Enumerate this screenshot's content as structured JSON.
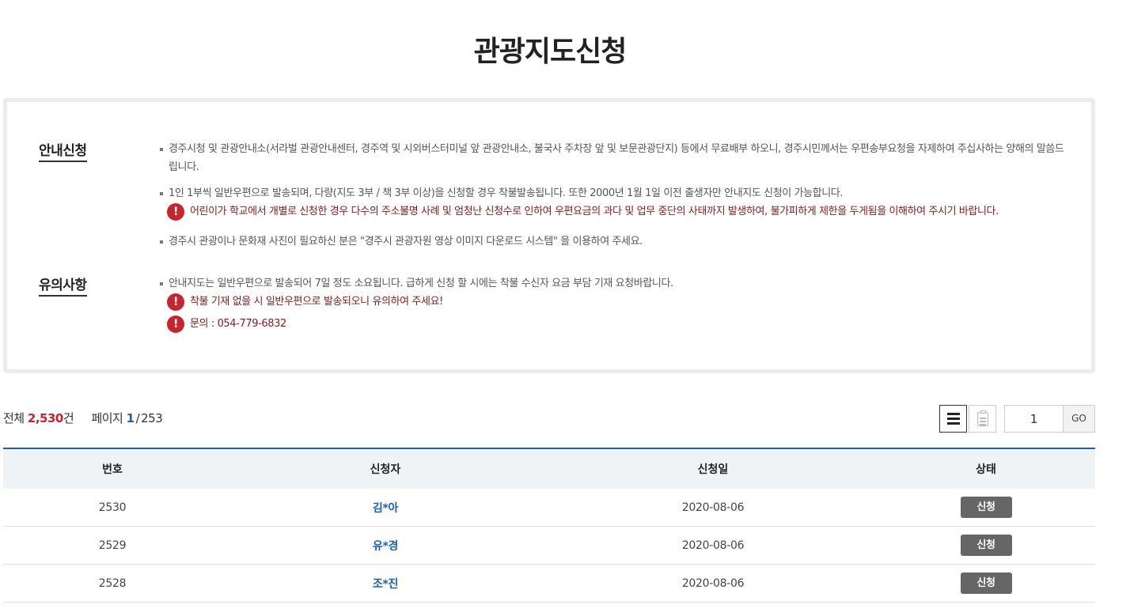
{
  "page_title": "관광지도신청",
  "info": {
    "section1_label": "안내신청",
    "section1_bullets": [
      "경주시청 및 관광안내소(서라벌 관광안내센터, 경주역 및 시외버스터미널 앞 관광안내소, 불국사 주차장 앞 및 보문관광단지) 등에서 무료배부 하오니, 경주시민께서는 우편송부요청을 자제하여 주십사하는 양해의 말씀드립니다.",
      "1인 1부씩 일반우편으로 발송되며, 다량(지도 3부 / 책 3부 이상)을 신청할 경우 착불발송됩니다. 또한 2000년 1월 1일 이전 출생자만 안내지도 신청이 가능합니다.",
      "경주시 관광이나 문화재 사진이 필요하신 분은 \"경주시 관광자원 영상 이미지 다운로드 시스템\" 을 이용하여 주세요."
    ],
    "section1_warning": "어린이가 학교에서 개별로 신청한 경우 다수의 주소불명 사례 및 엄청난 신청수로 인하여 우편요금의 과다 및 업무 중단의 사태까지 발생하여, 불가피하게 제한을 두게됨을 이해하여 주시기 바랍니다.",
    "section2_label": "유의사항",
    "section2_bullet": "안내지도는 일반우편으로 발송되어 7일 정도 소요됩니다. 급하게 신청 할 시에는 착불 수신자 요금 부담 기재 요청바랍니다.",
    "section2_warnings": [
      "착불 기재 없을 시 일반우편으로 발송되오니 유의하여 주세요!",
      "문의 : 054-779-6832"
    ],
    "warn_icon_glyph": "!"
  },
  "summary": {
    "total_label": "전체",
    "total_count": "2,530",
    "total_unit": "건",
    "page_label": "페이지",
    "page_current": "1",
    "page_total": "253"
  },
  "pager": {
    "page_input_value": "1",
    "go_label": "GO"
  },
  "table": {
    "headers": [
      "번호",
      "신청자",
      "신청일",
      "상태"
    ],
    "rows": [
      {
        "no": "2530",
        "applicant": "김*아",
        "date": "2020-08-06",
        "status": "신청"
      },
      {
        "no": "2529",
        "applicant": "유*경",
        "date": "2020-08-06",
        "status": "신청"
      },
      {
        "no": "2528",
        "applicant": "조*진",
        "date": "2020-08-06",
        "status": "신청"
      }
    ]
  },
  "colors": {
    "accent_blue": "#1a5fb4",
    "accent_red": "#c8242d",
    "badge_gray": "#666666"
  }
}
